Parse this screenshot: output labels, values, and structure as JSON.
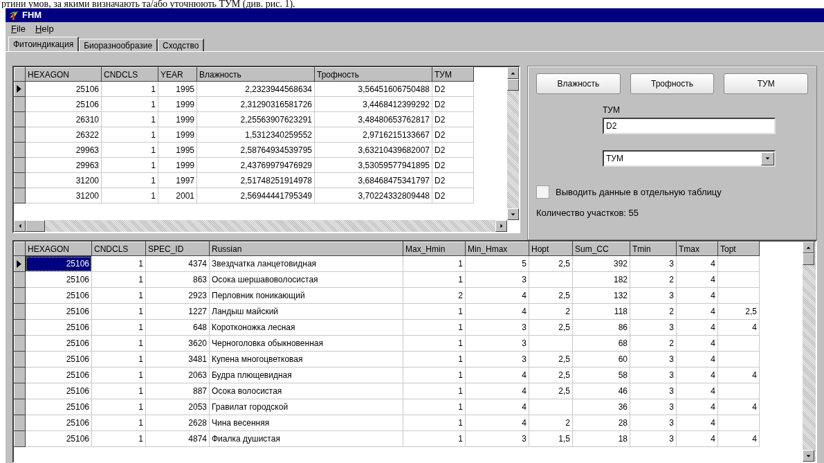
{
  "document_text": "ртини умов, за якими визначають та/або уточнюють ТУМ (див. рис. 1).",
  "window": {
    "title": "FHM"
  },
  "menu": [
    {
      "label": "File"
    },
    {
      "label": "Help"
    }
  ],
  "tabs": [
    {
      "label": "Фитоиндикация",
      "selected": true
    },
    {
      "label": "Биоразнообразие",
      "selected": false
    },
    {
      "label": "Сходство",
      "selected": false
    }
  ],
  "top_grid": {
    "columns": [
      {
        "label": "HEXAGON",
        "kind": "number"
      },
      {
        "label": "CNDCLS",
        "kind": "number"
      },
      {
        "label": "YEAR",
        "kind": "number"
      },
      {
        "label": "Влажность",
        "kind": "number"
      },
      {
        "label": "Трофность",
        "kind": "number"
      },
      {
        "label": "ТУМ",
        "kind": "text"
      }
    ],
    "rows": [
      {
        "current": true,
        "cells": [
          "25106",
          "1",
          "1995",
          "2,2323944568634",
          "3,56451606750488",
          "D2"
        ]
      },
      {
        "current": false,
        "cells": [
          "25106",
          "1",
          "1999",
          "2,31290316581726",
          "3,4468412399292",
          "D2"
        ]
      },
      {
        "current": false,
        "cells": [
          "26310",
          "1",
          "1999",
          "2,25563907623291",
          "3,48480653762817",
          "D2"
        ]
      },
      {
        "current": false,
        "cells": [
          "26322",
          "1",
          "1999",
          "1,5312340259552",
          "2,9716215133667",
          "D2"
        ]
      },
      {
        "current": false,
        "cells": [
          "29963",
          "1",
          "1995",
          "2,58764934539795",
          "3,63210439682007",
          "D2"
        ]
      },
      {
        "current": false,
        "cells": [
          "29963",
          "1",
          "1999",
          "2,43769979476929",
          "3,53059577941895",
          "D2"
        ]
      },
      {
        "current": false,
        "cells": [
          "31200",
          "1",
          "1997",
          "2,51748251914978",
          "3,68468475341797",
          "D2"
        ]
      },
      {
        "current": false,
        "cells": [
          "31200",
          "1",
          "2001",
          "2,56944441795349",
          "3,70224332809448",
          "D2"
        ]
      }
    ]
  },
  "panel": {
    "buttons": [
      "Влажность",
      "Трофность",
      "ТУМ"
    ],
    "field_label": "ТУМ",
    "field_value": "D2",
    "dropdown_value": "ТУМ",
    "checkbox": {
      "label": "Выводить данные в отдельную таблицу",
      "checked": false
    },
    "count": "Количество участков: 55"
  },
  "bottom_grid": {
    "columns": [
      {
        "label": "HEXAGON",
        "kind": "number"
      },
      {
        "label": "CNDCLS",
        "kind": "number"
      },
      {
        "label": "SPEC_ID",
        "kind": "number"
      },
      {
        "label": "Russian",
        "kind": "text"
      },
      {
        "label": "Max_Hmin",
        "kind": "number"
      },
      {
        "label": "Min_Hmax",
        "kind": "number"
      },
      {
        "label": "Hopt",
        "kind": "number"
      },
      {
        "label": "Sum_CC",
        "kind": "number"
      },
      {
        "label": "Tmin",
        "kind": "number"
      },
      {
        "label": "Tmax",
        "kind": "number"
      },
      {
        "label": "Topt",
        "kind": "number"
      }
    ],
    "rows": [
      {
        "current": true,
        "cell_selected": true,
        "cells": [
          "25106",
          "1",
          "4374",
          "Звездчатка ланцетовидная",
          "1",
          "5",
          "2,5",
          "392",
          "3",
          "4",
          ""
        ]
      },
      {
        "current": false,
        "cell_selected": false,
        "cells": [
          "25106",
          "1",
          "863",
          "Осока шершавоволосистая",
          "1",
          "3",
          "",
          "182",
          "2",
          "4",
          ""
        ]
      },
      {
        "current": false,
        "cell_selected": false,
        "cells": [
          "25106",
          "1",
          "2923",
          "Перловник поникающий",
          "2",
          "4",
          "2,5",
          "132",
          "3",
          "4",
          ""
        ]
      },
      {
        "current": false,
        "cell_selected": false,
        "cells": [
          "25106",
          "1",
          "1227",
          "Ландыш майский",
          "1",
          "4",
          "2",
          "118",
          "2",
          "4",
          "2,5"
        ]
      },
      {
        "current": false,
        "cell_selected": false,
        "cells": [
          "25106",
          "1",
          "648",
          "Коротконожка лесная",
          "1",
          "3",
          "2,5",
          "86",
          "3",
          "4",
          "4"
        ]
      },
      {
        "current": false,
        "cell_selected": false,
        "cells": [
          "25106",
          "1",
          "3620",
          "Черноголовка обыкновенная",
          "1",
          "3",
          "",
          "68",
          "2",
          "4",
          ""
        ]
      },
      {
        "current": false,
        "cell_selected": false,
        "cells": [
          "25106",
          "1",
          "3481",
          "Купена многоцветковая",
          "1",
          "3",
          "2,5",
          "60",
          "3",
          "4",
          ""
        ]
      },
      {
        "current": false,
        "cell_selected": false,
        "cells": [
          "25106",
          "1",
          "2063",
          "Будра плющевидная",
          "1",
          "4",
          "2,5",
          "58",
          "3",
          "4",
          "4"
        ]
      },
      {
        "current": false,
        "cell_selected": false,
        "cells": [
          "25106",
          "1",
          "887",
          "Осока волосистая",
          "1",
          "4",
          "2,5",
          "46",
          "3",
          "4",
          ""
        ]
      },
      {
        "current": false,
        "cell_selected": false,
        "cells": [
          "25106",
          "1",
          "2053",
          "Гравилат городской",
          "1",
          "4",
          "",
          "36",
          "3",
          "4",
          "4"
        ]
      },
      {
        "current": false,
        "cell_selected": false,
        "cells": [
          "25106",
          "1",
          "2628",
          "Чина весенняя",
          "1",
          "4",
          "2",
          "28",
          "3",
          "4",
          ""
        ]
      },
      {
        "current": false,
        "cell_selected": false,
        "cells": [
          "25106",
          "1",
          "4874",
          "Фиалка душистая",
          "1",
          "3",
          "1,5",
          "18",
          "3",
          "4",
          "4"
        ]
      }
    ]
  }
}
